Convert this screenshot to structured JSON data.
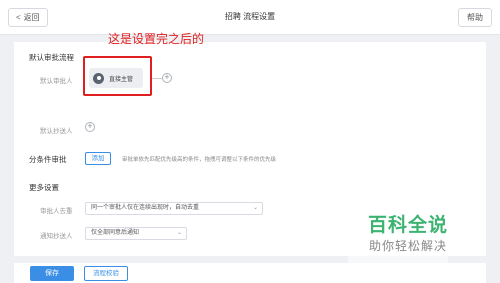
{
  "header": {
    "back_label": "返回",
    "title": "招聘 流程设置",
    "help_label": "帮助"
  },
  "annotation": "这是设置完之后的",
  "default_flow": {
    "section_title": "默认审批流程",
    "approver_label": "默认审批人",
    "approver_name": "直接主管",
    "cc_label": "默认抄送人"
  },
  "conditional": {
    "label": "分条件审批",
    "add_button": "添加",
    "hint": "审批单依先匹配优先级高的条件，拖拽可调整以下条件的优先级"
  },
  "more_settings": {
    "section_title": "更多设置",
    "dedupe_label": "审批人去重",
    "dedupe_value": "同一个审批人仅在连续出现时，自动去重",
    "notify_label": "通知抄送人",
    "notify_value": "仅全部同意后通知"
  },
  "footer": {
    "save_label": "保存",
    "check_label": "流程校验"
  },
  "watermark": {
    "logo": "百科全说",
    "subtitle": "助你轻松解决"
  },
  "colors": {
    "accent": "#3a8ee6",
    "annotation": "#e02020",
    "watermark": "#3cb371"
  }
}
